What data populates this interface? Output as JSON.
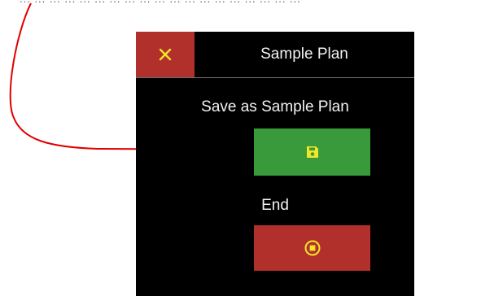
{
  "top_text": "... ... ... ... ... ... ... ... ... ... ... ... ... ... ... ... ... ... ...",
  "dialog": {
    "title": "Sample Plan",
    "close_icon": "close-icon",
    "save_label": "Save as Sample Plan",
    "save_icon": "floppy-disk-icon",
    "end_label": "End",
    "end_icon": "stop-circle-icon"
  },
  "colors": {
    "panel_bg": "#000000",
    "close_bg": "#b2302b",
    "save_bg": "#389a3a",
    "end_bg": "#b2302b",
    "icon_yellow": "#f3e629",
    "arrow": "#e00000"
  }
}
